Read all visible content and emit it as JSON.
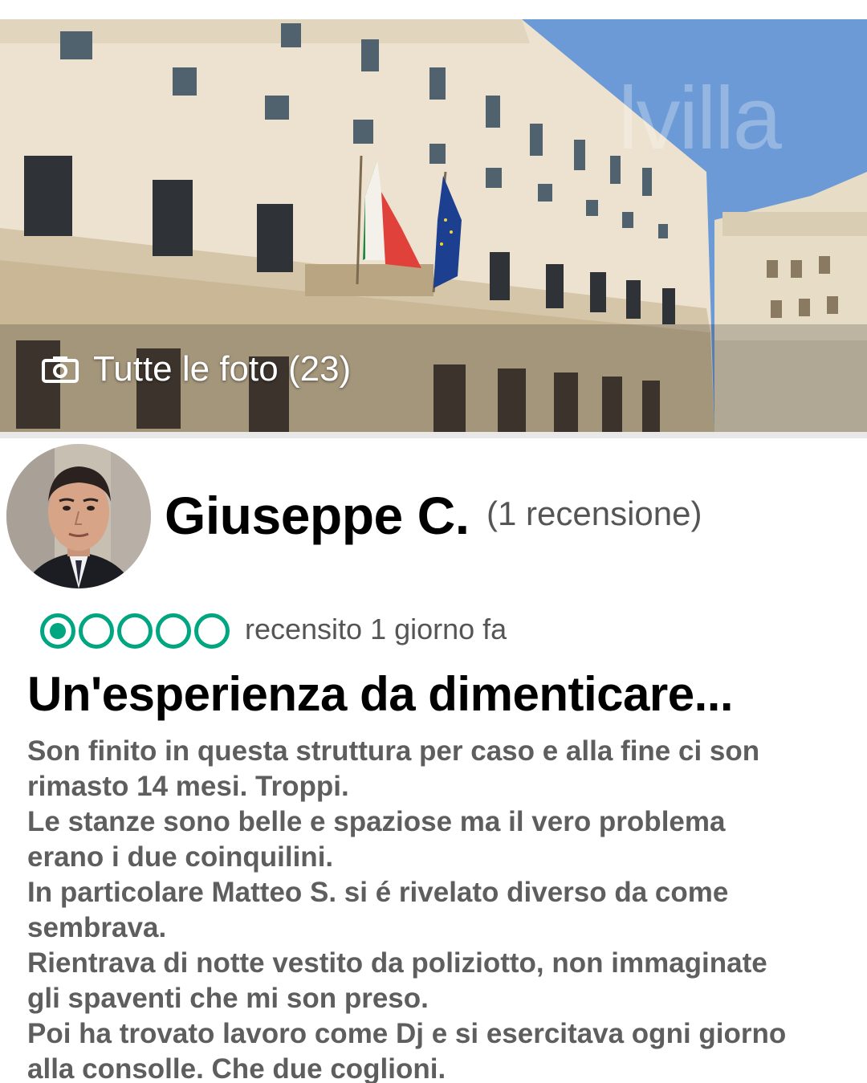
{
  "hero": {
    "photos_label": "Tutte le foto (23)",
    "photos_icon": "camera-icon",
    "watermark": "lvilla"
  },
  "review": {
    "reviewer_name": "Giuseppe C.",
    "review_count": "(1 recensione)",
    "rating": {
      "value": 1,
      "max": 5,
      "color": "#00a680"
    },
    "date": "recensito 1 giorno fa",
    "title": "Un'esperienza da dimenticare...",
    "body_lines": [
      "Son finito in questa struttura per caso e alla fine ci son",
      "rimasto 14 mesi. Troppi.",
      "Le stanze sono belle e spaziose ma il vero problema",
      "erano i due coinquilini.",
      "In particolare Matteo S. si é rivelato diverso da come",
      "sembrava.",
      "Rientrava di notte vestito da poliziotto, non immaginate",
      "gli spaventi che mi son preso.",
      "Poi ha trovato lavoro come Dj e si esercitava ogni giorno",
      "alla consolle. Che due coglioni."
    ]
  }
}
